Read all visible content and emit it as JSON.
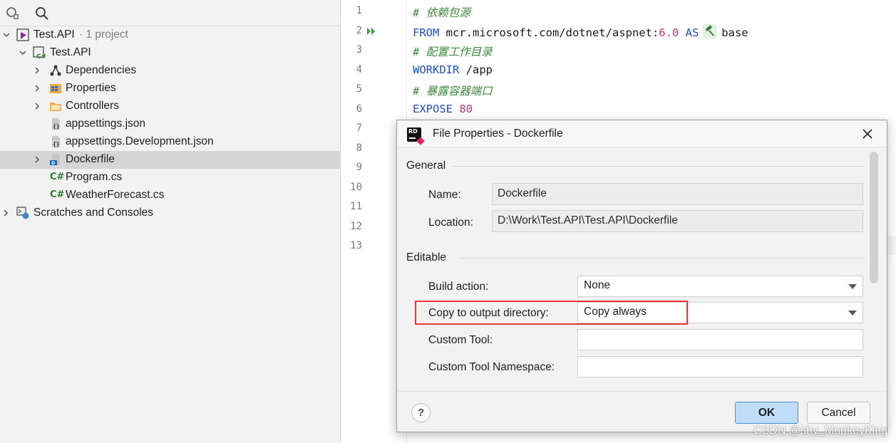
{
  "explorer": {
    "tree": [
      {
        "label": "Test.API",
        "meta": " · 1 project",
        "icon": "solution-icon"
      },
      {
        "label": "Test.API",
        "icon": "csharp-project-icon"
      },
      {
        "label": "Dependencies",
        "icon": "dependencies-icon"
      },
      {
        "label": "Properties",
        "icon": "properties-icon"
      },
      {
        "label": "Controllers",
        "icon": "folder-icon"
      },
      {
        "label": "appsettings.json",
        "icon": "json-file-icon"
      },
      {
        "label": "appsettings.Development.json",
        "icon": "json-file-icon"
      },
      {
        "label": "Dockerfile",
        "icon": "dockerfile-icon"
      },
      {
        "label": "Program.cs",
        "icon": "csharp-file-icon",
        "badge": "C#"
      },
      {
        "label": "WeatherForecast.cs",
        "icon": "csharp-file-icon",
        "badge": "C#"
      },
      {
        "label": "Scratches and Consoles",
        "icon": "scratches-icon"
      }
    ]
  },
  "editor": {
    "line_numbers": [
      "1",
      "2",
      "3",
      "4",
      "5",
      "6",
      "7",
      "8",
      "9",
      "10",
      "11",
      "12",
      "13"
    ],
    "code": {
      "l1": "# 依赖包源",
      "l2_kw1": "FROM",
      "l2_img": " mcr.microsoft.com/dotnet/aspnet:",
      "l2_ver": "6.0",
      "l2_as": " AS",
      "l2_alias": "base",
      "l3": "# 配置工作目录",
      "l4_kw": "WORKDIR",
      "l4_arg": " /app",
      "l5": "# 暴露容器端口",
      "l6_kw": "EXPOSE",
      "l6_port": " 80"
    }
  },
  "dialog": {
    "title": "File Properties - Dockerfile",
    "sections": {
      "general": "General",
      "editable": "Editable"
    },
    "fields": {
      "name_label": "Name:",
      "name_value": "Dockerfile",
      "location_label": "Location:",
      "location_value": "D:\\Work\\Test.API\\Test.API\\Dockerfile",
      "build_action_label": "Build action:",
      "build_action_value": "None",
      "copy_label": "Copy to output directory:",
      "copy_value": "Copy always",
      "custom_tool_label": "Custom Tool:",
      "custom_tool_value": "",
      "custom_ns_label": "Custom Tool Namespace:",
      "custom_ns_value": ""
    },
    "buttons": {
      "help": "?",
      "ok": "OK",
      "cancel": "Cancel"
    },
    "logo_text": "RD",
    "highlight_color": "#e53935"
  },
  "watermark": "CSDN @shy_MonkeyKing"
}
